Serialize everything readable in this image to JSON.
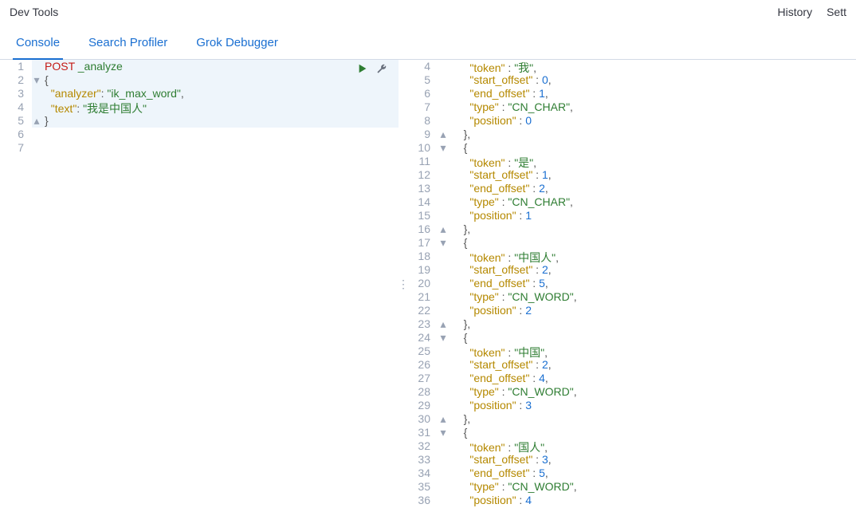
{
  "app": {
    "title": "Dev Tools"
  },
  "topRight": {
    "history": "History",
    "settings": "Sett"
  },
  "tabs": {
    "console": "Console",
    "searchProfiler": "Search Profiler",
    "grokDebugger": "Grok Debugger",
    "active": "console"
  },
  "request": {
    "method": "POST",
    "path": "_analyze",
    "body": {
      "analyzer": "ik_max_word",
      "text": "我是中国人"
    },
    "lineNumbers": [
      "1",
      "2",
      "3",
      "4",
      "5",
      "6",
      "7"
    ],
    "folds": [
      "",
      "▾",
      "",
      "",
      "▴",
      "",
      ""
    ]
  },
  "response": {
    "startLine": 4,
    "lines": [
      {
        "ln": 4,
        "fold": "",
        "indent": 3,
        "type": "kv_str",
        "key": "token",
        "val": "我",
        "comma": true
      },
      {
        "ln": 5,
        "fold": "",
        "indent": 3,
        "type": "kv_num",
        "key": "start_offset",
        "val": "0",
        "comma": true
      },
      {
        "ln": 6,
        "fold": "",
        "indent": 3,
        "type": "kv_num",
        "key": "end_offset",
        "val": "1",
        "comma": true
      },
      {
        "ln": 7,
        "fold": "",
        "indent": 3,
        "type": "kv_str",
        "key": "type",
        "val": "CN_CHAR",
        "comma": true
      },
      {
        "ln": 8,
        "fold": "",
        "indent": 3,
        "type": "kv_num",
        "key": "position",
        "val": "0",
        "comma": false
      },
      {
        "ln": 9,
        "fold": "▴",
        "indent": 2,
        "type": "close",
        "text": "},"
      },
      {
        "ln": 10,
        "fold": "▾",
        "indent": 2,
        "type": "open",
        "text": "{"
      },
      {
        "ln": 11,
        "fold": "",
        "indent": 3,
        "type": "kv_str",
        "key": "token",
        "val": "是",
        "comma": true
      },
      {
        "ln": 12,
        "fold": "",
        "indent": 3,
        "type": "kv_num",
        "key": "start_offset",
        "val": "1",
        "comma": true
      },
      {
        "ln": 13,
        "fold": "",
        "indent": 3,
        "type": "kv_num",
        "key": "end_offset",
        "val": "2",
        "comma": true
      },
      {
        "ln": 14,
        "fold": "",
        "indent": 3,
        "type": "kv_str",
        "key": "type",
        "val": "CN_CHAR",
        "comma": true
      },
      {
        "ln": 15,
        "fold": "",
        "indent": 3,
        "type": "kv_num",
        "key": "position",
        "val": "1",
        "comma": false
      },
      {
        "ln": 16,
        "fold": "▴",
        "indent": 2,
        "type": "close",
        "text": "},"
      },
      {
        "ln": 17,
        "fold": "▾",
        "indent": 2,
        "type": "open",
        "text": "{"
      },
      {
        "ln": 18,
        "fold": "",
        "indent": 3,
        "type": "kv_str",
        "key": "token",
        "val": "中国人",
        "comma": true
      },
      {
        "ln": 19,
        "fold": "",
        "indent": 3,
        "type": "kv_num",
        "key": "start_offset",
        "val": "2",
        "comma": true
      },
      {
        "ln": 20,
        "fold": "",
        "indent": 3,
        "type": "kv_num",
        "key": "end_offset",
        "val": "5",
        "comma": true
      },
      {
        "ln": 21,
        "fold": "",
        "indent": 3,
        "type": "kv_str",
        "key": "type",
        "val": "CN_WORD",
        "comma": true
      },
      {
        "ln": 22,
        "fold": "",
        "indent": 3,
        "type": "kv_num",
        "key": "position",
        "val": "2",
        "comma": false
      },
      {
        "ln": 23,
        "fold": "▴",
        "indent": 2,
        "type": "close",
        "text": "},"
      },
      {
        "ln": 24,
        "fold": "▾",
        "indent": 2,
        "type": "open",
        "text": "{"
      },
      {
        "ln": 25,
        "fold": "",
        "indent": 3,
        "type": "kv_str",
        "key": "token",
        "val": "中国",
        "comma": true
      },
      {
        "ln": 26,
        "fold": "",
        "indent": 3,
        "type": "kv_num",
        "key": "start_offset",
        "val": "2",
        "comma": true
      },
      {
        "ln": 27,
        "fold": "",
        "indent": 3,
        "type": "kv_num",
        "key": "end_offset",
        "val": "4",
        "comma": true
      },
      {
        "ln": 28,
        "fold": "",
        "indent": 3,
        "type": "kv_str",
        "key": "type",
        "val": "CN_WORD",
        "comma": true
      },
      {
        "ln": 29,
        "fold": "",
        "indent": 3,
        "type": "kv_num",
        "key": "position",
        "val": "3",
        "comma": false
      },
      {
        "ln": 30,
        "fold": "▴",
        "indent": 2,
        "type": "close",
        "text": "},"
      },
      {
        "ln": 31,
        "fold": "▾",
        "indent": 2,
        "type": "open",
        "text": "{"
      },
      {
        "ln": 32,
        "fold": "",
        "indent": 3,
        "type": "kv_str",
        "key": "token",
        "val": "国人",
        "comma": true
      },
      {
        "ln": 33,
        "fold": "",
        "indent": 3,
        "type": "kv_num",
        "key": "start_offset",
        "val": "3",
        "comma": true
      },
      {
        "ln": 34,
        "fold": "",
        "indent": 3,
        "type": "kv_num",
        "key": "end_offset",
        "val": "5",
        "comma": true
      },
      {
        "ln": 35,
        "fold": "",
        "indent": 3,
        "type": "kv_str",
        "key": "type",
        "val": "CN_WORD",
        "comma": true
      },
      {
        "ln": 36,
        "fold": "",
        "indent": 3,
        "type": "kv_num",
        "key": "position",
        "val": "4",
        "comma": false
      }
    ]
  }
}
